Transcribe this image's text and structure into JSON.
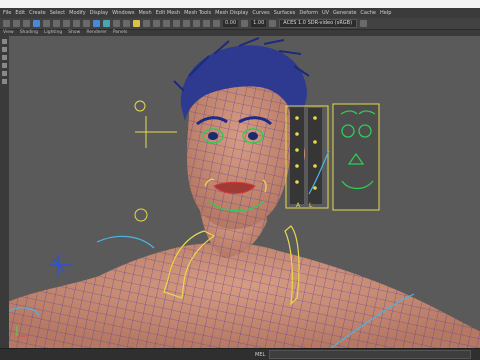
{
  "menubar": {
    "items": [
      "File",
      "Edit",
      "Create",
      "Select",
      "Modify",
      "Display",
      "Windows",
      "Mesh",
      "Edit Mesh",
      "Mesh Tools",
      "Mesh Display",
      "Curves",
      "Surfaces",
      "Deform",
      "UV",
      "Generate",
      "Cache",
      "Help"
    ]
  },
  "toolbar": {
    "field1": "0.00",
    "field2": "1.00",
    "camera_select": "ACES 1.0 SDR-video (sRGB)"
  },
  "panel_menu": {
    "items": [
      "View",
      "Shading",
      "Lighting",
      "Show",
      "Renderer",
      "Panels"
    ]
  },
  "viewport": {
    "rig_panel_labels": {
      "left": "A",
      "right": "L"
    }
  },
  "statusbar": {
    "label": "MEL"
  }
}
